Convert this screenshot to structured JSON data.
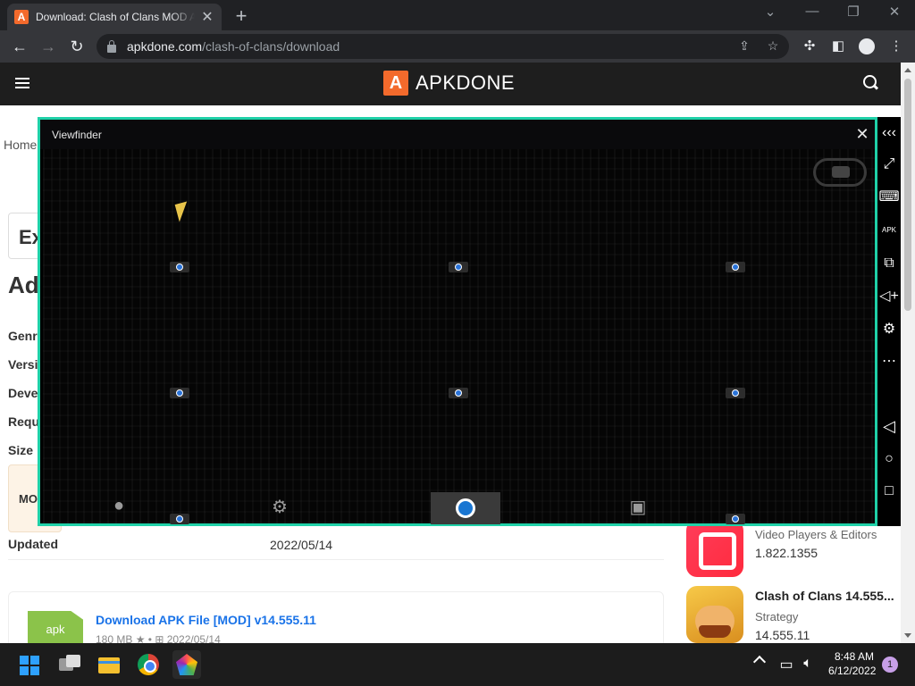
{
  "browser": {
    "tab_title": "Download: Clash of Clans MOD APK",
    "favicon_letter": "A",
    "url_host": "apkdone.com",
    "url_path": "/clash-of-clans/download"
  },
  "site": {
    "logo_letter": "A",
    "logo_text": "APKDONE",
    "breadcrumb": "Home",
    "ex_text": "Ex",
    "ad_heading": "Ad",
    "info_rows": [
      "Genr",
      "Versi",
      "Deve",
      "Requ",
      "Size"
    ],
    "mod_label": "MO",
    "updated_label": "Updated",
    "updated_value": "2022/05/14",
    "download_link": "Download APK File [MOD] v14.555.11",
    "download_meta": "180 MB ★ • ⊞ 2022/05/14",
    "apk_badge": "apk",
    "sidebar_apps": [
      {
        "title": "",
        "category": "Video Players & Editors",
        "version": "1.822.1355"
      },
      {
        "title": "Clash of Clans 14.555...",
        "category": "Strategy",
        "version": "14.555.11"
      }
    ]
  },
  "viewfinder": {
    "title": "Viewfinder",
    "close": "✕"
  },
  "emulator_toolbar": {
    "icons": [
      "collapse-icon",
      "fullscreen-icon",
      "keyboard-icon",
      "apk-install-icon",
      "multi-instance-icon",
      "volume-icon",
      "settings-icon",
      "more-icon",
      "back-icon",
      "home-icon",
      "recents-icon"
    ],
    "apk_text": "APK"
  },
  "taskbar": {
    "time": "8:48 AM",
    "date": "6/12/2022",
    "notification_count": "1"
  },
  "colors": {
    "accent": "#1fd1a8",
    "brand": "#f36a2c"
  }
}
